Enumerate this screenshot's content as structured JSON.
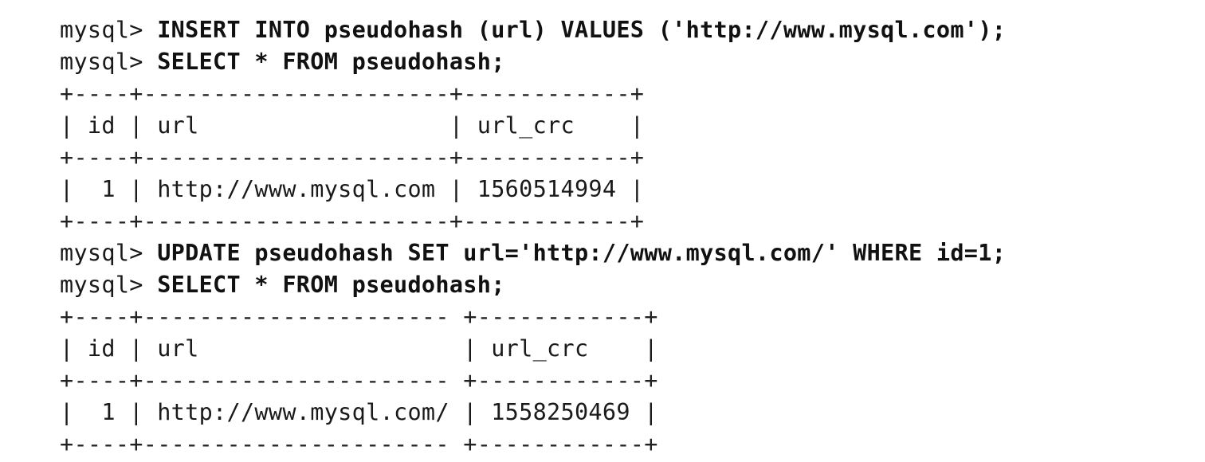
{
  "listing": {
    "lines": [
      {
        "kind": "command",
        "prompt": "mysql> ",
        "text": "INSERT INTO pseudohash (url) VALUES ('http://www.mysql.com');"
      },
      {
        "kind": "command",
        "prompt": "mysql> ",
        "text": "SELECT * FROM pseudohash;"
      },
      {
        "kind": "border",
        "text": "+----+----------------------+------------+"
      },
      {
        "kind": "row",
        "text": "| id | url                  | url_crc    |"
      },
      {
        "kind": "border",
        "text": "+----+----------------------+------------+"
      },
      {
        "kind": "row",
        "text": "|  1 | http://www.mysql.com | 1560514994 |"
      },
      {
        "kind": "border",
        "text": "+----+----------------------+------------+"
      },
      {
        "kind": "command",
        "prompt": "mysql> ",
        "text": "UPDATE pseudohash SET url='http://www.mysql.com/' WHERE id=1;"
      },
      {
        "kind": "command",
        "prompt": "mysql> ",
        "text": "SELECT * FROM pseudohash;"
      },
      {
        "kind": "border",
        "text": "+----+---------------------- +------------+"
      },
      {
        "kind": "row",
        "text": "| id | url                   | url_crc    |"
      },
      {
        "kind": "border",
        "text": "+----+---------------------- +------------+"
      },
      {
        "kind": "row",
        "text": "|  1 | http://www.mysql.com/ | 1558250469 |"
      },
      {
        "kind": "border",
        "text": "+----+---------------------- +------------+"
      }
    ]
  }
}
